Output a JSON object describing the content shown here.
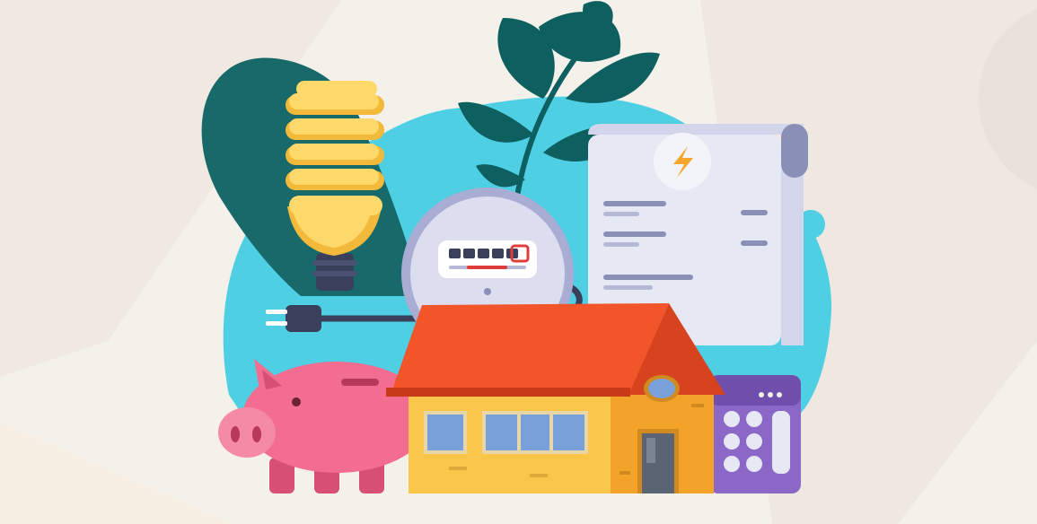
{
  "scene": {
    "subject": "energy-bill-savings-illustration",
    "elements": [
      "cfl-light-bulb",
      "electric-meter",
      "electricity-bill",
      "lightning-bolt-icon",
      "plant-leaves",
      "piggy-bank",
      "house",
      "calculator",
      "power-plug-cable"
    ]
  },
  "colors": {
    "background": "#f4f0ea",
    "blob_cyan": "#4fcfe3",
    "blob_teal": "#17696a",
    "leaf": "#0e5f5f",
    "bulb_yellow": "#fcd96a",
    "bulb_shade": "#f2b93b",
    "meter_body": "#c9cbe7",
    "meter_red": "#e03c3c",
    "bill_paper": "#e6e8f4",
    "bill_line": "#8a8fb8",
    "bolt": "#f4a52a",
    "roof": "#f2552a",
    "house_wall": "#f9c64a",
    "house_side": "#f4a32a",
    "window": "#7aa0d9",
    "door": "#5a6472",
    "piggy": "#f26d8f",
    "calculator": "#8b67c7",
    "cable": "#3a3f5c"
  }
}
